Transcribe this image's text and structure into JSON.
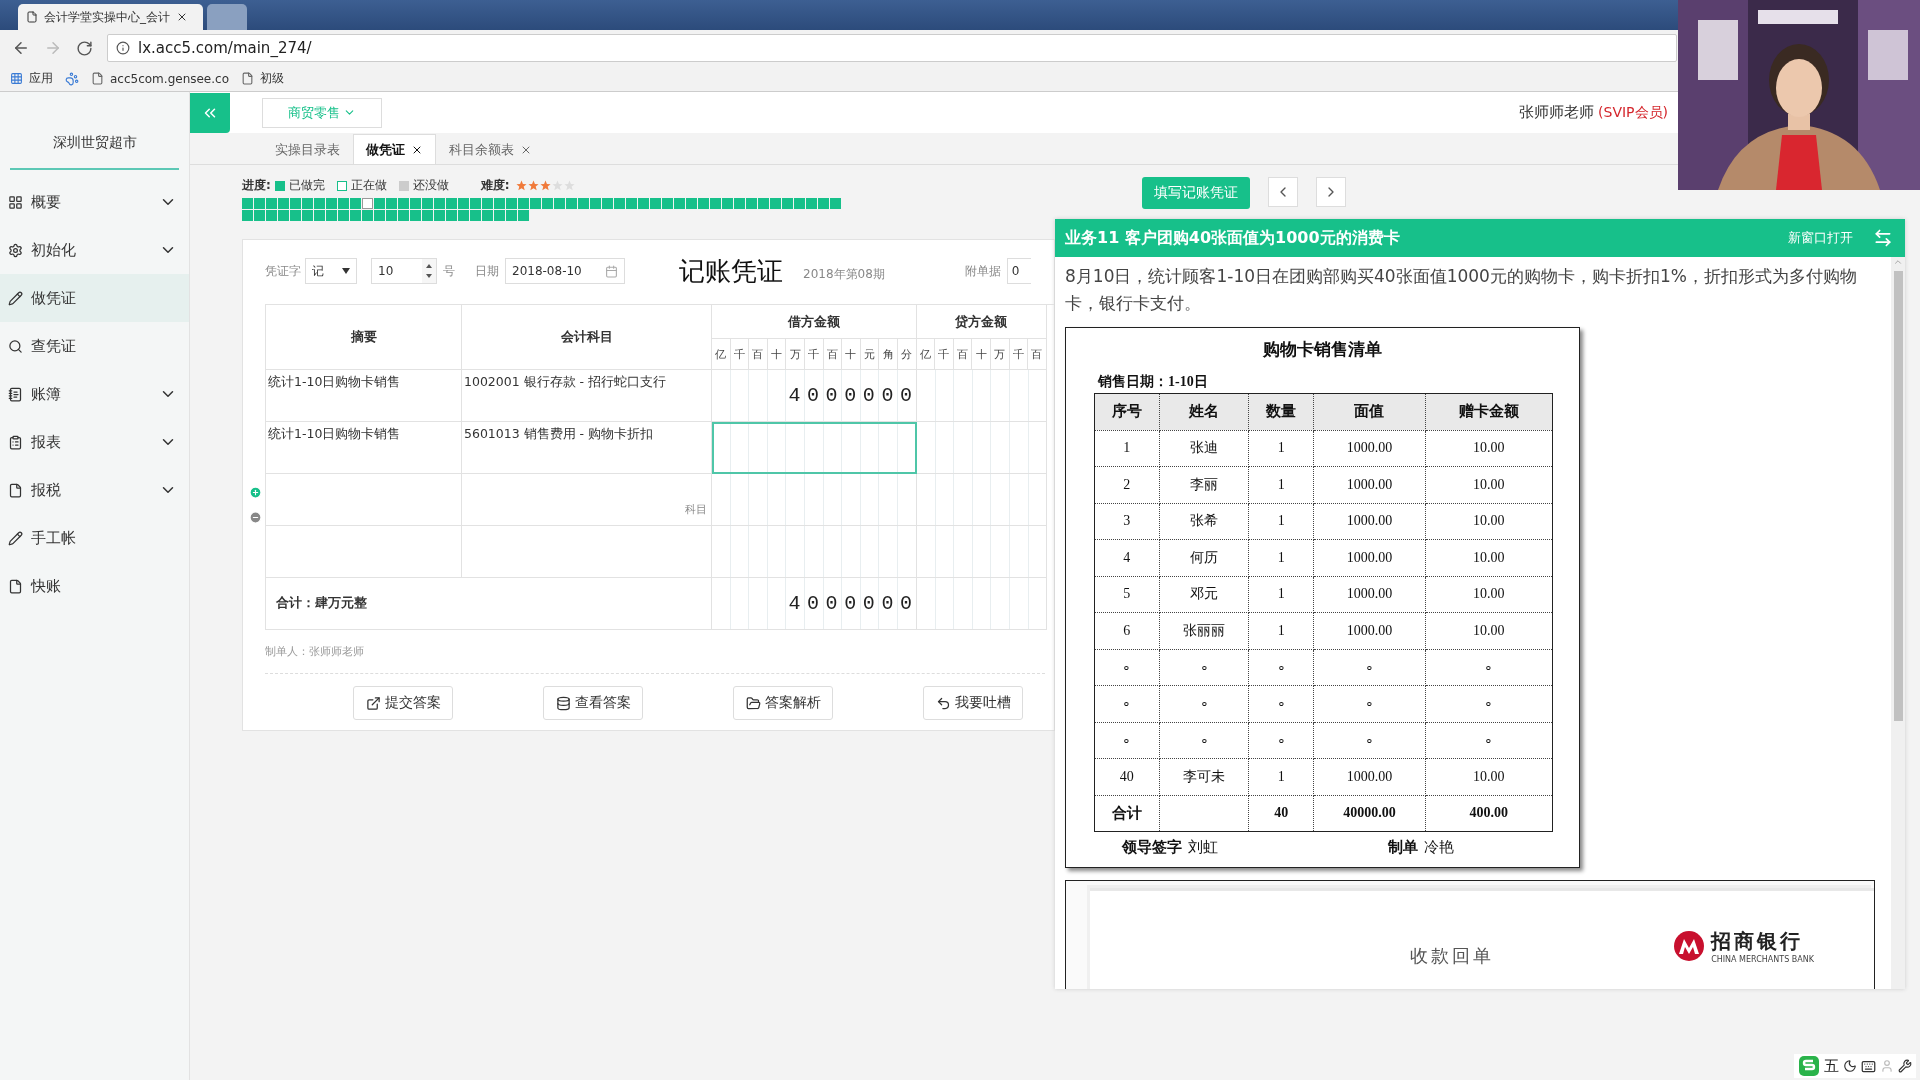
{
  "browser": {
    "tabs": [
      {
        "title": "会计学堂实操中心_会计",
        "selected": true
      },
      {
        "selected": false
      }
    ],
    "address": "lx.acc5.com/main_274/",
    "bookmarks": [
      {
        "kind": "apps",
        "label": "应用"
      },
      {
        "kind": "paw"
      },
      {
        "kind": "page",
        "label": "acc5com.gensee.co"
      },
      {
        "kind": "page",
        "label": "初级"
      }
    ]
  },
  "sidebar": {
    "company": "深圳世贸超市",
    "items": [
      {
        "kind": "grid",
        "label": "概要",
        "expandable": true,
        "selected": false
      },
      {
        "kind": "gear",
        "label": "初始化",
        "expandable": true,
        "selected": false
      },
      {
        "kind": "pencil",
        "label": "做凭证",
        "expandable": false,
        "selected": true
      },
      {
        "kind": "search",
        "label": "查凭证",
        "expandable": false,
        "selected": false
      },
      {
        "kind": "ledger",
        "label": "账簿",
        "expandable": true,
        "selected": false
      },
      {
        "kind": "report",
        "label": "报表",
        "expandable": true,
        "selected": false
      },
      {
        "kind": "file",
        "label": "报税",
        "expandable": true,
        "selected": false
      },
      {
        "kind": "pencil",
        "label": "手工帐",
        "expandable": false,
        "selected": false
      },
      {
        "kind": "file",
        "label": "快账",
        "expandable": false,
        "selected": false
      }
    ]
  },
  "header": {
    "industry": "商贸零售",
    "user": "张师师老师",
    "member": "(SVIP会员)"
  },
  "page_tabs": [
    {
      "label": "实操目录表",
      "closable": false,
      "selected": false
    },
    {
      "label": "做凭证",
      "closable": true,
      "selected": true
    },
    {
      "label": "科目余额表",
      "closable": true,
      "selected": false
    }
  ],
  "progress": {
    "label": "进度:",
    "legend": [
      {
        "label": "已做完",
        "kind": "done"
      },
      {
        "label": "正在做",
        "kind": "current"
      },
      {
        "label": "还没做",
        "kind": "todo"
      }
    ],
    "difficulty_label": "难度:",
    "stars": 3,
    "tasks": [
      {
        "done": true,
        "current": false
      },
      {
        "done": true,
        "current": false
      },
      {
        "done": true,
        "current": false
      },
      {
        "done": true,
        "current": false
      },
      {
        "done": true,
        "current": false
      },
      {
        "done": true,
        "current": false
      },
      {
        "done": true,
        "current": false
      },
      {
        "done": true,
        "current": false
      },
      {
        "done": true,
        "current": false
      },
      {
        "done": true,
        "current": false
      },
      {
        "done": false,
        "current": true
      },
      {
        "done": true,
        "current": false
      },
      {
        "done": true,
        "current": false
      },
      {
        "done": true,
        "current": false
      },
      {
        "done": true,
        "current": false
      },
      {
        "done": true,
        "current": false
      },
      {
        "done": true,
        "current": false
      },
      {
        "done": true,
        "current": false
      },
      {
        "done": true,
        "current": false
      },
      {
        "done": true,
        "current": false
      },
      {
        "done": true,
        "current": false
      },
      {
        "done": true,
        "current": false
      },
      {
        "done": true,
        "current": false
      },
      {
        "done": true,
        "current": false
      },
      {
        "done": true,
        "current": false
      },
      {
        "done": true,
        "current": false
      },
      {
        "done": true,
        "current": false
      },
      {
        "done": true,
        "current": false
      },
      {
        "done": true,
        "current": false
      },
      {
        "done": true,
        "current": false
      },
      {
        "done": true,
        "current": false
      },
      {
        "done": true,
        "current": false
      },
      {
        "done": true,
        "current": false
      },
      {
        "done": true,
        "current": false
      },
      {
        "done": true,
        "current": false
      },
      {
        "done": true,
        "current": false
      },
      {
        "done": true,
        "current": false
      },
      {
        "done": true,
        "current": false
      },
      {
        "done": true,
        "current": false
      },
      {
        "done": true,
        "current": false
      },
      {
        "done": true,
        "current": false
      },
      {
        "done": true,
        "current": false
      },
      {
        "done": true,
        "current": false
      },
      {
        "done": true,
        "current": false
      },
      {
        "done": true,
        "current": false
      },
      {
        "done": true,
        "current": false
      },
      {
        "done": true,
        "current": false
      },
      {
        "done": true,
        "current": false
      },
      {
        "done": true,
        "current": false
      },
      {
        "done": true,
        "current": false
      },
      {
        "done": true,
        "current": false
      },
      {
        "done": true,
        "current": false
      },
      {
        "done": true,
        "current": false
      },
      {
        "done": true,
        "current": false
      },
      {
        "done": true,
        "current": false
      },
      {
        "done": true,
        "current": false
      },
      {
        "done": true,
        "current": false
      },
      {
        "done": true,
        "current": false
      },
      {
        "done": true,
        "current": false
      },
      {
        "done": true,
        "current": false
      },
      {
        "done": true,
        "current": false
      },
      {
        "done": true,
        "current": false
      },
      {
        "done": true,
        "current": false
      },
      {
        "done": true,
        "current": false
      },
      {
        "done": true,
        "current": false
      },
      {
        "done": true,
        "current": false
      },
      {
        "done": true,
        "current": false
      },
      {
        "done": true,
        "current": false
      },
      {
        "done": true,
        "current": false
      },
      {
        "done": true,
        "current": false
      },
      {
        "done": true,
        "current": false
      },
      {
        "done": true,
        "current": false
      },
      {
        "done": true,
        "current": false
      },
      {
        "done": true,
        "current": false
      }
    ]
  },
  "fill_button": "填写记账凭证",
  "voucher": {
    "type_label": "凭证字",
    "type": "记",
    "number": "10",
    "number_suffix": "号",
    "date_label": "日期",
    "date": "2018-08-10",
    "title": "记账凭证",
    "period": "2018年第08期",
    "attachments_label": "附单据",
    "attachments": "0",
    "columns": {
      "summary": "摘要",
      "account": "会计科目",
      "debit": "借方金额",
      "credit": "贷方金额"
    },
    "debit_units": [
      "亿",
      "千",
      "百",
      "十",
      "万",
      "千",
      "百",
      "十",
      "元",
      "角",
      "分"
    ],
    "credit_units": [
      "亿",
      "千",
      "百",
      "十",
      "万",
      "千",
      "百"
    ],
    "rows": [
      {
        "summary": "统计1-10日购物卡销售",
        "account": "1002001 银行存款 - 招行蛇口支行",
        "debit": "4000000",
        "selected": false
      },
      {
        "summary": "统计1-10日购物卡销售",
        "account": "5601013 销售费用 - 购物卡折扣",
        "selected": true
      },
      {
        "account_placeholder": "科目",
        "selected": false
      },
      {
        "selected": false
      }
    ],
    "total_label": "合计：肆万元整",
    "total_debit": "4000000",
    "maker": "制单人：张师师老师",
    "actions": [
      {
        "kind": "submit",
        "label": "提交答案"
      },
      {
        "kind": "answer",
        "label": "查看答案"
      },
      {
        "kind": "analysis",
        "label": "答案解析"
      },
      {
        "kind": "feedback",
        "label": "我要吐槽"
      }
    ]
  },
  "task_panel": {
    "title": "业务11 客户团购40张面值为1000元的消费卡",
    "open_new": "新窗口打开",
    "description": "8月10日，统计顾客1-10日在团购部购买40张面值1000元的购物卡，购卡折扣1%，折扣形式为多付购物卡，银行卡支付。",
    "sheet": {
      "title": "购物卡销售清单",
      "date": "销售日期：1-10日",
      "columns": [
        "序号",
        "姓名",
        "数量",
        "面值",
        "赠卡金额"
      ],
      "rows": [
        [
          "1",
          "张迪",
          "1",
          "1000.00",
          "10.00"
        ],
        [
          "2",
          "李丽",
          "1",
          "1000.00",
          "10.00"
        ],
        [
          "3",
          "张希",
          "1",
          "1000.00",
          "10.00"
        ],
        [
          "4",
          "何历",
          "1",
          "1000.00",
          "10.00"
        ],
        [
          "5",
          "邓元",
          "1",
          "1000.00",
          "10.00"
        ],
        [
          "6",
          "张丽丽",
          "1",
          "1000.00",
          "10.00"
        ],
        [
          "∘",
          "∘",
          "∘",
          "∘",
          "∘"
        ],
        [
          "∘",
          "∘",
          "∘",
          "∘",
          "∘"
        ],
        [
          "∘",
          "∘",
          "∘",
          "∘",
          "∘"
        ],
        [
          "40",
          "李可未",
          "1",
          "1000.00",
          "10.00"
        ]
      ],
      "total": {
        "label": "合计",
        "quantity": "40",
        "face_value": "40000.00",
        "gift": "400.00"
      },
      "leader_label": "领导签字",
      "leader": "刘虹",
      "maker_label": "制单",
      "maker": "冷艳"
    },
    "receipt": {
      "title": "收款回单",
      "bank": "招商银行",
      "bank_en": "CHINA MERCHANTS BANK"
    }
  },
  "ime": {
    "label": "五"
  }
}
